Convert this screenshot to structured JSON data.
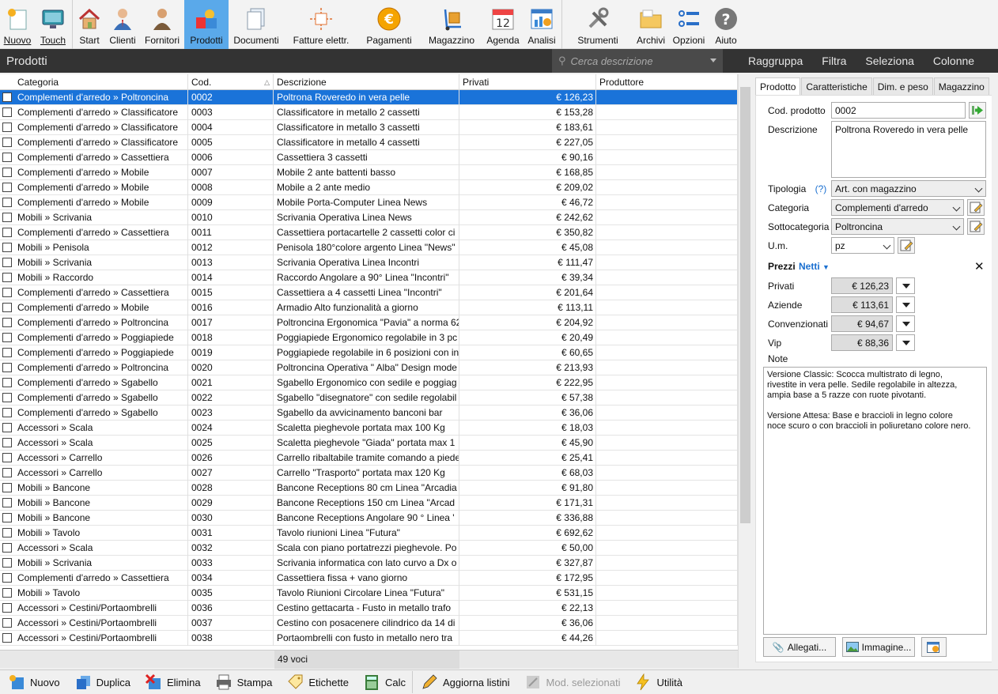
{
  "toolbar": [
    {
      "label": "Nuovo",
      "icon": "new-document-icon"
    },
    {
      "label": "Touch",
      "icon": "touch-monitor-icon"
    },
    {
      "label": "Start",
      "icon": "home-icon"
    },
    {
      "label": "Clienti",
      "icon": "client-person-icon"
    },
    {
      "label": "Fornitori",
      "icon": "supplier-person-icon"
    },
    {
      "label": "Prodotti",
      "icon": "products-icon",
      "active": true
    },
    {
      "label": "Documenti",
      "icon": "documents-icon"
    },
    {
      "label": "Fatture elettr.",
      "icon": "electronic-invoice-icon"
    },
    {
      "label": "Pagamenti",
      "icon": "euro-coin-icon"
    },
    {
      "label": "Magazzino",
      "icon": "warehouse-trolley-icon"
    },
    {
      "label": "Agenda",
      "icon": "calendar-icon",
      "text": "12"
    },
    {
      "label": "Analisi",
      "icon": "analysis-chart-icon"
    },
    {
      "label": "Strumenti",
      "icon": "tools-icon"
    },
    {
      "label": "Archivi",
      "icon": "folder-icon"
    },
    {
      "label": "Opzioni",
      "icon": "options-icon"
    },
    {
      "label": "Aiuto",
      "icon": "help-icon"
    }
  ],
  "title": "Prodotti",
  "search_placeholder": "Cerca descrizione",
  "title_menu": [
    "Raggruppa",
    "Filtra",
    "Seleziona",
    "Colonne"
  ],
  "columns": [
    "Categoria",
    "Cod.",
    "Descrizione",
    "Privati",
    "Produttore"
  ],
  "rows": [
    [
      "Complementi d'arredo  »  Poltroncina",
      "0002",
      "Poltrona Roveredo in vera pelle",
      "€ 126,23"
    ],
    [
      "Complementi d'arredo  »  Classificatore",
      "0003",
      "Classificatore in metallo 2 cassetti",
      "€ 153,28"
    ],
    [
      "Complementi d'arredo  »  Classificatore",
      "0004",
      "Classificatore in metallo 3 cassetti",
      "€ 183,61"
    ],
    [
      "Complementi d'arredo  »  Classificatore",
      "0005",
      "Classificatore in metallo 4 cassetti",
      "€ 227,05"
    ],
    [
      "Complementi d'arredo  »  Cassettiera",
      "0006",
      "Cassettiera 3 cassetti",
      "€ 90,16"
    ],
    [
      "Complementi d'arredo  »  Mobile",
      "0007",
      "Mobile 2 ante battenti basso",
      "€ 168,85"
    ],
    [
      "Complementi d'arredo  »  Mobile",
      "0008",
      "Mobile a 2 ante medio",
      "€ 209,02"
    ],
    [
      "Complementi d'arredo  »  Mobile",
      "0009",
      "Mobile Porta-Computer Linea News",
      "€ 46,72"
    ],
    [
      "Mobili  »  Scrivania",
      "0010",
      "Scrivania Operativa Linea News",
      "€ 242,62"
    ],
    [
      "Complementi d'arredo  »  Cassettiera",
      "0011",
      "Cassettiera portacartelle 2 cassetti color ci",
      "€ 350,82"
    ],
    [
      "Mobili  »  Penisola",
      "0012",
      "Penisola 180°colore argento Linea \"News\"",
      "€ 45,08"
    ],
    [
      "Mobili  »  Scrivania",
      "0013",
      "Scrivania Operativa Linea Incontri",
      "€ 111,47"
    ],
    [
      "Mobili  »  Raccordo",
      "0014",
      "Raccordo Angolare a 90° Linea \"Incontri\"",
      "€ 39,34"
    ],
    [
      "Complementi d'arredo  »  Cassettiera",
      "0015",
      "Cassettiera a 4 cassetti Linea \"Incontri\"",
      "€ 201,64"
    ],
    [
      "Complementi d'arredo  »  Mobile",
      "0016",
      "Armadio Alto funzionalità a giorno",
      "€ 113,11"
    ],
    [
      "Complementi d'arredo  »  Poltroncina",
      "0017",
      "Poltroncina Ergonomica \"Pavia\" a norma 62",
      "€ 204,92"
    ],
    [
      "Complementi d'arredo  »  Poggiapiede",
      "0018",
      "Poggiapiede Ergonomico regolabile in 3 pc",
      "€ 20,49"
    ],
    [
      "Complementi d'arredo  »  Poggiapiede",
      "0019",
      "Poggiapiede regolabile in 6 posizioni con in",
      "€ 60,65"
    ],
    [
      "Complementi d'arredo  »  Poltroncina",
      "0020",
      "Poltroncina Operativa \" Alba\" Design mode",
      "€ 213,93"
    ],
    [
      "Complementi d'arredo  »  Sgabello",
      "0021",
      "Sgabello Ergonomico con sedile e poggiag",
      "€ 222,95"
    ],
    [
      "Complementi d'arredo  »  Sgabello",
      "0022",
      "Sgabello \"disegnatore\" con sedile regolabil",
      "€ 57,38"
    ],
    [
      "Complementi d'arredo  »  Sgabello",
      "0023",
      "Sgabello da avvicinamento banconi bar",
      "€ 36,06"
    ],
    [
      "Accessori  »  Scala",
      "0024",
      "Scaletta pieghevole portata max 100 Kg",
      "€ 18,03"
    ],
    [
      "Accessori  »  Scala",
      "0025",
      "Scaletta pieghevole \"Giada\" portata max 1",
      "€ 45,90"
    ],
    [
      "Accessori  »  Carrello",
      "0026",
      "Carrello ribaltabile tramite comando a piede",
      "€ 25,41"
    ],
    [
      "Accessori  »  Carrello",
      "0027",
      "Carrello \"Trasporto\"  portata max 120 Kg",
      "€ 68,03"
    ],
    [
      "Mobili  »  Bancone",
      "0028",
      "Bancone Receptions 80 cm Linea \"Arcadia",
      "€ 91,80"
    ],
    [
      "Mobili  »  Bancone",
      "0029",
      "Bancone Receptions 150 cm Linea \"Arcad",
      "€ 171,31"
    ],
    [
      "Mobili  »  Bancone",
      "0030",
      "Bancone Receptions Angolare 90 ° Linea '",
      "€ 336,88"
    ],
    [
      "Mobili  »  Tavolo",
      "0031",
      "Tavolo riunioni Linea \"Futura\"",
      "€ 692,62"
    ],
    [
      "Accessori  »  Scala",
      "0032",
      "Scala con piano portatrezzi pieghevole. Po",
      "€ 50,00"
    ],
    [
      "Mobili  »  Scrivania",
      "0033",
      "Scrivania informatica con lato curvo a Dx o",
      "€ 327,87"
    ],
    [
      "Complementi d'arredo  »  Cassettiera",
      "0034",
      "Cassettiera fissa + vano giorno",
      "€ 172,95"
    ],
    [
      "Mobili  »  Tavolo",
      "0035",
      "Tavolo Riunioni Circolare Linea \"Futura\"",
      "€ 531,15"
    ],
    [
      "Accessori  »  Cestini/Portaombrelli",
      "0036",
      "Cestino gettacarta - Fusto in metallo trafo",
      "€ 22,13"
    ],
    [
      "Accessori  »  Cestini/Portaombrelli",
      "0037",
      "Cestino con posacenere cilindrico da 14 di",
      "€ 36,06"
    ],
    [
      "Accessori  »  Cestini/Portaombrelli",
      "0038",
      "Portaombrelli con fusto in metallo nero tra",
      "€ 44,26"
    ]
  ],
  "footer_count": "49 voci",
  "panel": {
    "tabs": [
      "Prodotto",
      "Caratteristiche",
      "Dim. e peso",
      "Magazzino"
    ],
    "cod_label": "Cod. prodotto",
    "cod_value": "0002",
    "desc_label": "Descrizione",
    "desc_value": "Poltrona Roveredo in vera pelle",
    "tipologia_label": "Tipologia",
    "tipologia_help": "(?)",
    "tipologia_value": "Art. con magazzino",
    "categoria_label": "Categoria",
    "categoria_value": "Complementi d'arredo",
    "sottocat_label": "Sottocategoria",
    "sottocat_value": "Poltroncina",
    "um_label": "U.m.",
    "um_value": "pz",
    "prezzi_label": "Prezzi",
    "netti_label": "Netti",
    "prices": [
      {
        "label": "Privati",
        "value": "€ 126,23"
      },
      {
        "label": "Aziende",
        "value": "€ 113,61"
      },
      {
        "label": "Convenzionati",
        "value": "€ 94,67"
      },
      {
        "label": "Vip",
        "value": "€ 88,36"
      }
    ],
    "note_label": "Note",
    "note_text": "Versione Classic: Scocca multistrato di legno,\nrivestite in vera pelle. Sedile regolabile in altezza,\nampia base a 5 razze con ruote pivotanti.\n\nVersione Attesa: Base e braccioli in legno colore\nnoce scuro o con braccioli in poliuretano colore nero.",
    "allegati_label": "Allegati...",
    "immagine_label": "Immagine..."
  },
  "bottom_toolbar": [
    {
      "label": "Nuovo",
      "icon": "new-item-icon"
    },
    {
      "label": "Duplica",
      "icon": "duplicate-icon"
    },
    {
      "label": "Elimina",
      "icon": "delete-icon"
    },
    {
      "label": "Stampa",
      "icon": "printer-icon"
    },
    {
      "label": "Etichette",
      "icon": "label-tag-icon"
    },
    {
      "label": "Calc",
      "icon": "calculator-icon"
    },
    {
      "label": "Aggiorna listini",
      "icon": "pencil-icon"
    },
    {
      "label": "Mod. selezionati",
      "icon": "edit-selected-icon",
      "disabled": true
    },
    {
      "label": "Utilità",
      "icon": "lightning-icon"
    }
  ],
  "colors": {
    "accent": "#5aa9ea",
    "selection": "#1a73d9",
    "titlebar": "#333333",
    "link": "#1a6fd0"
  }
}
